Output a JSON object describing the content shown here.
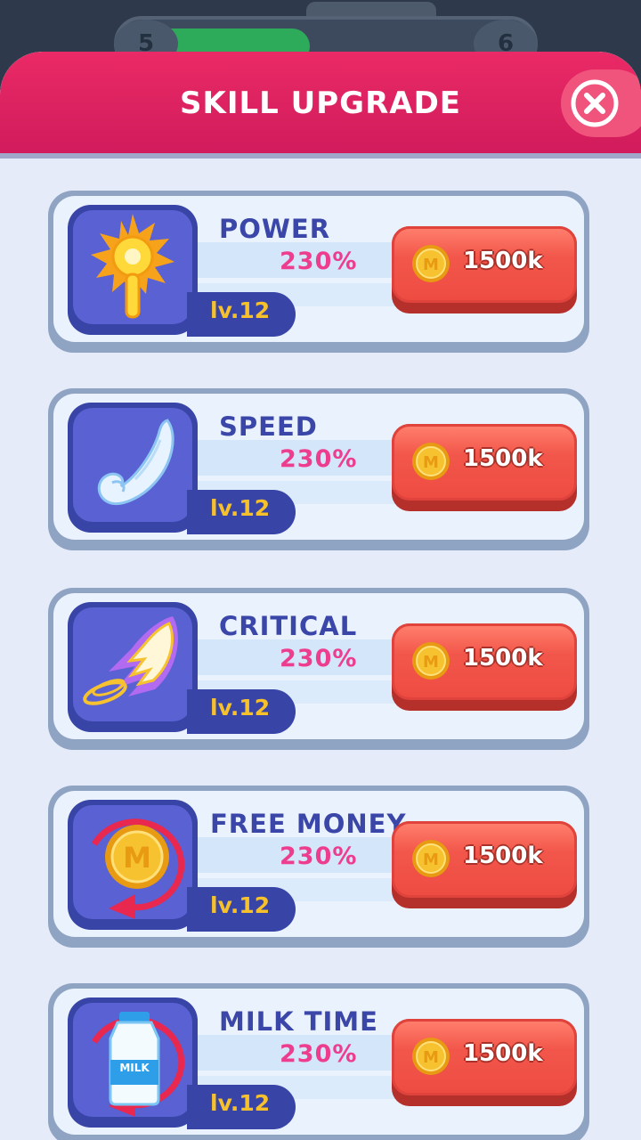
{
  "background": {
    "left_level": "5",
    "right_level": "6"
  },
  "header": {
    "title": "SKILL UPGRADE"
  },
  "skills": [
    {
      "name": "POWER",
      "percent": "230%",
      "level": "lv.12",
      "price": "1500k",
      "icon": "key-icon"
    },
    {
      "name": "SPEED",
      "percent": "230%",
      "level": "lv.12",
      "price": "1500k",
      "icon": "wing-icon"
    },
    {
      "name": "CRITICAL",
      "percent": "230%",
      "level": "lv.12",
      "price": "1500k",
      "icon": "critical-icon"
    },
    {
      "name": "FREE MONEY",
      "percent": "230%",
      "level": "lv.12",
      "price": "1500k",
      "icon": "coin-refresh-icon"
    },
    {
      "name": "MILK TIME",
      "percent": "230%",
      "level": "lv.12",
      "price": "1500k",
      "icon": "milk-refresh-icon",
      "milk_label": "MILK"
    }
  ],
  "colors": {
    "accent": "#d11b5c",
    "button": "#ee4c42",
    "panel": "#e6ebfa",
    "tile": "#5961d3"
  }
}
